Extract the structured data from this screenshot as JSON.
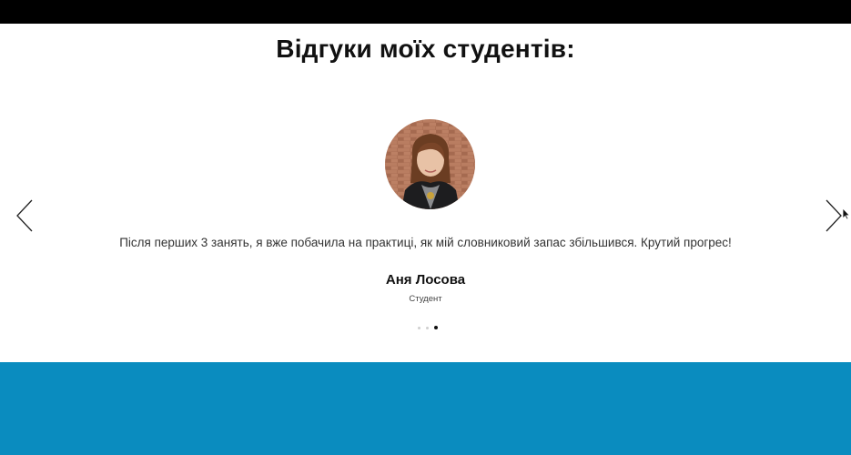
{
  "testimonials": {
    "title": "Відгуки моїх студентів:",
    "quote": "Після перших 3 занять, я вже побачила на практиці, як мій словниковий запас збільшився. Крутий прогрес!",
    "author_name": "Аня Лосова",
    "author_role": "Студент",
    "avatar_icon": "student-photo",
    "prev_icon": "chevron-left-icon",
    "next_icon": "chevron-right-icon",
    "slides": 3,
    "active_slide": 3
  },
  "next_section": {
    "background": "#0a8cbf",
    "heading": ""
  },
  "colors": {
    "top_bar": "#000000",
    "text": "#111111",
    "accent_blue": "#0a8cbf"
  }
}
